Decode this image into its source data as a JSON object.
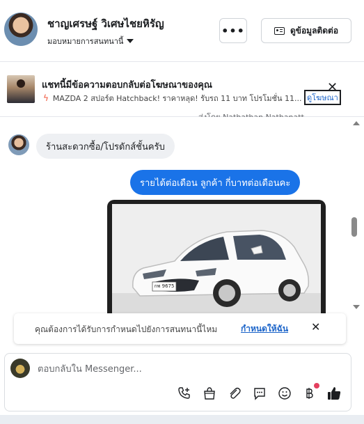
{
  "header": {
    "contact_name": "ชาญเศรษฐ์ วิเศษไชยหิรัญ",
    "assign_label": "มอบหมายการสนทนานี้",
    "more_label": "•••",
    "contact_info_label": "ดูข้อมูลติดต่อ"
  },
  "ad_banner": {
    "title": "แชทนี้มีข้อความตอบกลับต่อโฆษณาของคุณ",
    "subtitle": "MAZDA 2 สปอร์ต Hatchback! ราคาหลุด! รับรถ 11 บาท โปรโมชั่น 11...",
    "view_ad_label": "ดูโฆษณา",
    "partial_text": "ส่งโดย Nathathan Nathanatt"
  },
  "messages": [
    {
      "direction": "incoming",
      "text": "ร้านสะดวกซื้อ/โปรดักส์ชั้นครับ"
    },
    {
      "direction": "outgoing",
      "text": "รายได้ต่อเดือน  ลูกค้า  กี่บาทต่อเดือนคะ"
    }
  ],
  "car_image": {
    "plate": "กพ 9675"
  },
  "notice": {
    "text": "คุณต้องการได้รับการกำหนดไปยังการสนทนานี้ไหม",
    "link": "กำหนดให้ฉัน"
  },
  "composer": {
    "placeholder": "ตอบกลับใน Messenger..."
  },
  "colors": {
    "outgoing_bubble": "#1a73e8",
    "link": "#1b64c9",
    "badge": "#e4405f"
  },
  "icons": [
    "phone-plus-icon",
    "shopping-bag-icon",
    "paperclip-icon",
    "chat-bubble-icon",
    "emoji-icon",
    "baht-icon",
    "thumbs-up-icon"
  ]
}
